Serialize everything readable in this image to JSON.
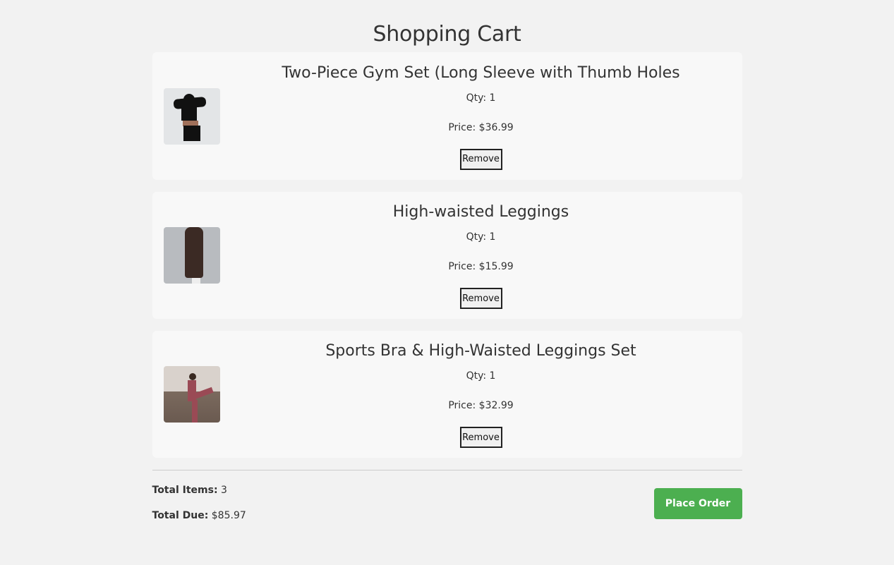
{
  "page": {
    "title": "Shopping Cart"
  },
  "items": [
    {
      "name": "Two-Piece Gym Set (Long Sleeve with Thumb Holes",
      "qty": "Qty: 1",
      "price": "Price: $36.99",
      "remove": "Remove",
      "image": "woman-black-gym-set-photo"
    },
    {
      "name": "High-waisted Leggings",
      "qty": "Qty: 1",
      "price": "Price: $15.99",
      "remove": "Remove",
      "image": "brown-leggings-photo"
    },
    {
      "name": "Sports Bra & High-Waisted Leggings Set",
      "qty": "Qty: 1",
      "price": "Price: $32.99",
      "remove": "Remove",
      "image": "pink-set-stretch-photo"
    }
  ],
  "summary": {
    "items_label": "Total Items:",
    "items_value": "3",
    "due_label": "Total Due:",
    "due_value": "$85.97",
    "place_order": "Place Order"
  },
  "colors": {
    "accent": "#4caf50"
  }
}
